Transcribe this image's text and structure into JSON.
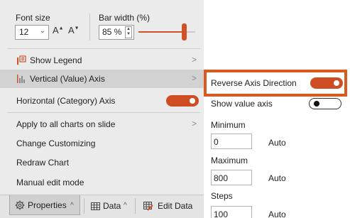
{
  "toolbar": {
    "font_size_label": "Font size",
    "font_size_value": "12",
    "grow_font": "A",
    "shrink_font": "A",
    "bar_width_label": "Bar width (%)",
    "bar_width_value": "85 %",
    "bar_width_percent": 85
  },
  "menu": {
    "show_legend": "Show Legend",
    "vertical_axis": "Vertical (Value) Axis",
    "horizontal_axis": "Horizontal (Category) Axis",
    "horizontal_axis_on": true,
    "apply_all": "Apply to all charts on slide",
    "change_customizing": "Change Customizing",
    "redraw_chart": "Redraw Chart",
    "manual_edit": "Manual edit mode",
    "arrow": ">"
  },
  "tabs": {
    "properties": "Properties",
    "data": "Data",
    "edit_data": "Edit Data",
    "caret": "^"
  },
  "submenu": {
    "reverse_axis": "Reverse Axis Direction",
    "reverse_axis_on": true,
    "show_value_axis": "Show value axis",
    "show_value_axis_on": false,
    "minimum_label": "Minimum",
    "minimum_value": "0",
    "minimum_auto": "Auto",
    "maximum_label": "Maximum",
    "maximum_value": "800",
    "maximum_auto": "Auto",
    "steps_label": "Steps",
    "steps_value": "100",
    "steps_auto": "Auto"
  },
  "colors": {
    "accent": "#cf4d23",
    "highlight_border": "#d85a1e"
  }
}
